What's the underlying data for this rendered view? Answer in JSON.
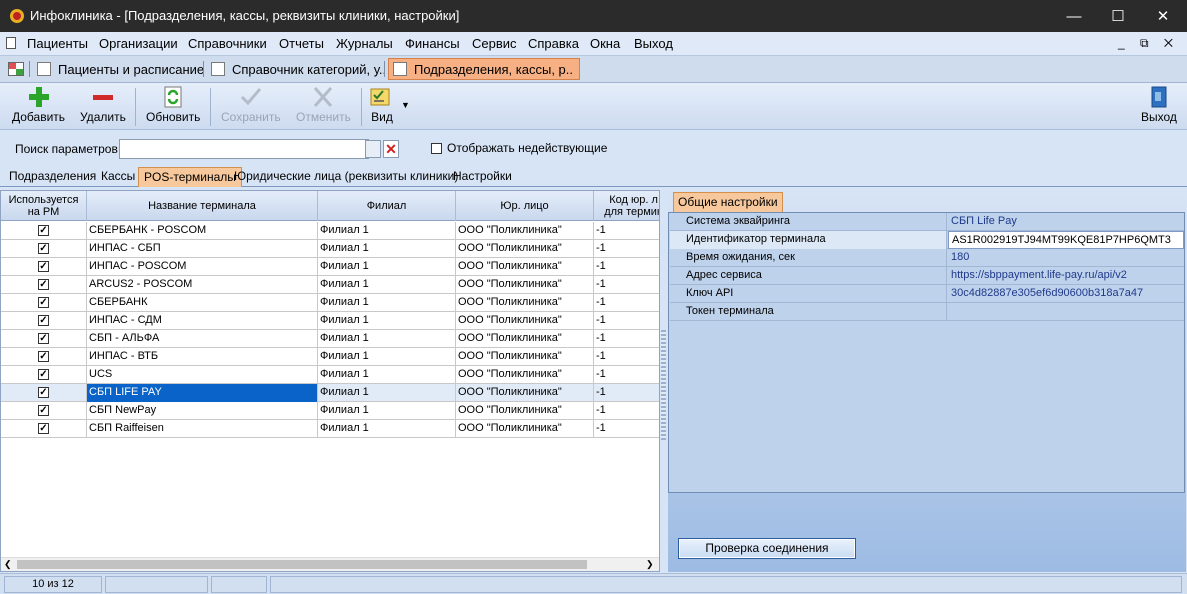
{
  "window": {
    "title": "Инфоклиника - [Подразделения, кассы, реквизиты клиники, настройки]",
    "minimize": "—",
    "maximize": "☐",
    "close": "✕"
  },
  "menu": {
    "items": [
      "Пациенты",
      "Организации",
      "Справочники",
      "Отчеты",
      "Журналы",
      "Финансы",
      "Сервис",
      "Справка",
      "Окна",
      "Выход"
    ],
    "mdi": "_ ⧉ ✕"
  },
  "doc_tabs": [
    {
      "label": "Пациенты и расписание"
    },
    {
      "label": "Справочник категорий, у.."
    },
    {
      "label": "Подразделения, кассы, р.."
    }
  ],
  "toolbar": {
    "add": "Добавить",
    "delete": "Удалить",
    "refresh": "Обновить",
    "save": "Сохранить",
    "cancel": "Отменить",
    "view": "Вид",
    "exit": "Выход"
  },
  "search": {
    "label": "Поиск параметров",
    "value": "",
    "show_inactive_label": "Отображать недействующие"
  },
  "subtabs": [
    "Подразделения",
    "Кассы",
    "POS-терминалы",
    "Юридические лица (реквизиты клиники)",
    "Настройки"
  ],
  "grid": {
    "headers": {
      "used": "Используется\nна РМ",
      "name": "Название терминала",
      "branch": "Филиал",
      "legal": "Юр. лицо",
      "code": "Код юр. л\nдля термин"
    },
    "rows": [
      {
        "used": true,
        "name": "СБЕРБАНК - POSCOM",
        "branch": "Филиал 1",
        "legal": "ООО \"Поликлиника\"",
        "code": "-1"
      },
      {
        "used": true,
        "name": "ИНПАС - СБП",
        "branch": "Филиал 1",
        "legal": "ООО \"Поликлиника\"",
        "code": "-1"
      },
      {
        "used": true,
        "name": "ИНПАС - POSCOM",
        "branch": "Филиал 1",
        "legal": "ООО \"Поликлиника\"",
        "code": "-1"
      },
      {
        "used": true,
        "name": "ARCUS2 - POSCOM",
        "branch": "Филиал 1",
        "legal": "ООО \"Поликлиника\"",
        "code": "-1"
      },
      {
        "used": true,
        "name": "СБЕРБАНК",
        "branch": "Филиал 1",
        "legal": "ООО \"Поликлиника\"",
        "code": "-1"
      },
      {
        "used": true,
        "name": "ИНПАС - СДМ",
        "branch": "Филиал 1",
        "legal": "ООО \"Поликлиника\"",
        "code": "-1"
      },
      {
        "used": true,
        "name": "СБП - АЛЬФА",
        "branch": "Филиал 1",
        "legal": "ООО \"Поликлиника\"",
        "code": "-1"
      },
      {
        "used": true,
        "name": "ИНПАС - ВТБ",
        "branch": "Филиал 1",
        "legal": "ООО \"Поликлиника\"",
        "code": "-1"
      },
      {
        "used": true,
        "name": "UCS",
        "branch": "Филиал 1",
        "legal": "ООО \"Поликлиника\"",
        "code": "-1"
      },
      {
        "used": true,
        "name": "СБП LIFE PAY",
        "branch": "Филиал 1",
        "legal": "ООО \"Поликлиника\"",
        "code": "-1"
      },
      {
        "used": true,
        "name": "СБП NewPay",
        "branch": "Филиал 1",
        "legal": "ООО \"Поликлиника\"",
        "code": "-1"
      },
      {
        "used": true,
        "name": "СБП Raiffeisen",
        "branch": "Филиал 1",
        "legal": "ООО \"Поликлиника\"",
        "code": "-1"
      }
    ],
    "selected_index": 9
  },
  "props": {
    "tab": "Общие настройки",
    "rows": [
      {
        "name": "Система эквайринга",
        "value": "СБП Life Pay"
      },
      {
        "name": "Идентификатор терминала",
        "value": "AS1R002919TJ94MT99KQE81P7HP6QMT3"
      },
      {
        "name": "Время ожидания, сек",
        "value": "180"
      },
      {
        "name": "Адрес сервиса",
        "value": "https://sbppayment.life-pay.ru/api/v2"
      },
      {
        "name": "Ключ API",
        "value": "30c4d82887e305ef6d90600b318a7a47"
      },
      {
        "name": "Токен терминала",
        "value": ""
      }
    ],
    "focus_index": 1,
    "check_button": "Проверка соединения"
  },
  "status": {
    "count": "10 из 12"
  },
  "colors": {
    "accent_tab": "#f7b083",
    "selection": "#0a63c9",
    "title_bg": "#2b2b2b"
  }
}
